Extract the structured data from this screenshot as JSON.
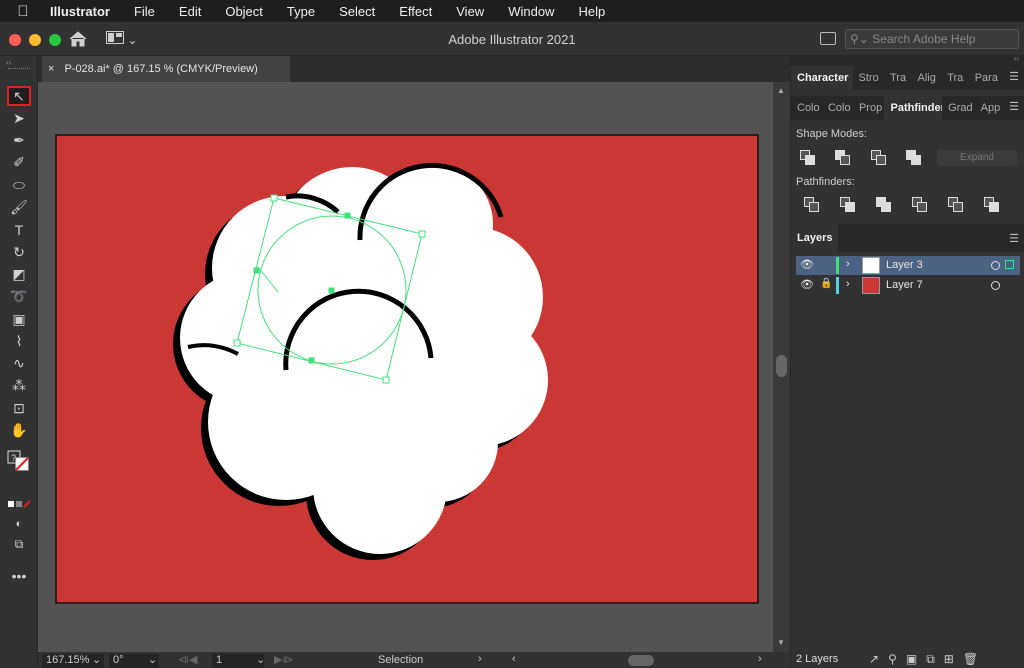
{
  "menubar": {
    "apple": "",
    "items": [
      "Illustrator",
      "File",
      "Edit",
      "Object",
      "Type",
      "Select",
      "Effect",
      "View",
      "Window",
      "Help"
    ]
  },
  "titlebar": {
    "title": "Adobe Illustrator 2021",
    "search_placeholder": "Search Adobe Help",
    "workspace_icon": "grid-layout-icon"
  },
  "document_tab": {
    "close": "×",
    "name": "P-028.ai* @ 167.15 % (CMYK/Preview)"
  },
  "tools": [
    {
      "name": "selection-tool-icon",
      "glyph": "↖",
      "selected": true
    },
    {
      "name": "direct-selection-tool-icon",
      "glyph": "➤"
    },
    {
      "name": "pen-tool-icon",
      "glyph": "✒"
    },
    {
      "name": "curvature-tool-icon",
      "glyph": "✐"
    },
    {
      "name": "ellipse-tool-icon",
      "glyph": "⬭"
    },
    {
      "name": "paintbrush-tool-icon",
      "glyph": "🖌"
    },
    {
      "name": "type-tool-icon",
      "glyph": "T"
    },
    {
      "name": "rotate-tool-icon",
      "glyph": "↻"
    },
    {
      "name": "eraser-tool-icon",
      "glyph": "◩"
    },
    {
      "name": "lasso-tool-icon",
      "glyph": "➰"
    },
    {
      "name": "gradient-tool-icon",
      "glyph": "▣"
    },
    {
      "name": "eyedropper-tool-icon",
      "glyph": "⌇"
    },
    {
      "name": "blend-tool-icon",
      "glyph": "∿"
    },
    {
      "name": "symbol-sprayer-tool-icon",
      "glyph": "⁂"
    },
    {
      "name": "artboard-tool-icon",
      "glyph": "⊡"
    },
    {
      "name": "hand-tool-icon",
      "glyph": "✋"
    }
  ],
  "more_tools": "•••",
  "status": {
    "zoom": "167.15%",
    "rotation": "0°",
    "artboard": "1",
    "tool": "Selection"
  },
  "panels": {
    "top_tabs": [
      "Character",
      "Stro",
      "Tra",
      "Alig",
      "Tra",
      "Para"
    ],
    "second_tabs": [
      "Colo",
      "Colo",
      "Prop",
      "Pathfinder",
      "Grad",
      "App"
    ],
    "shape_modes_label": "Shape Modes:",
    "expand_label": "Expand",
    "pathfinders_label": "Pathfinders:",
    "layers_tab": "Layers",
    "layers": [
      {
        "name": "Layer 3",
        "color": "#41e17a",
        "locked": false,
        "selected": true
      },
      {
        "name": "Layer 7",
        "color": "#53d3e6",
        "locked": true,
        "selected": false
      }
    ],
    "layers_count": "2 Layers"
  },
  "colors": {
    "artboard": "#cb3735",
    "selection": "#41e17a"
  }
}
